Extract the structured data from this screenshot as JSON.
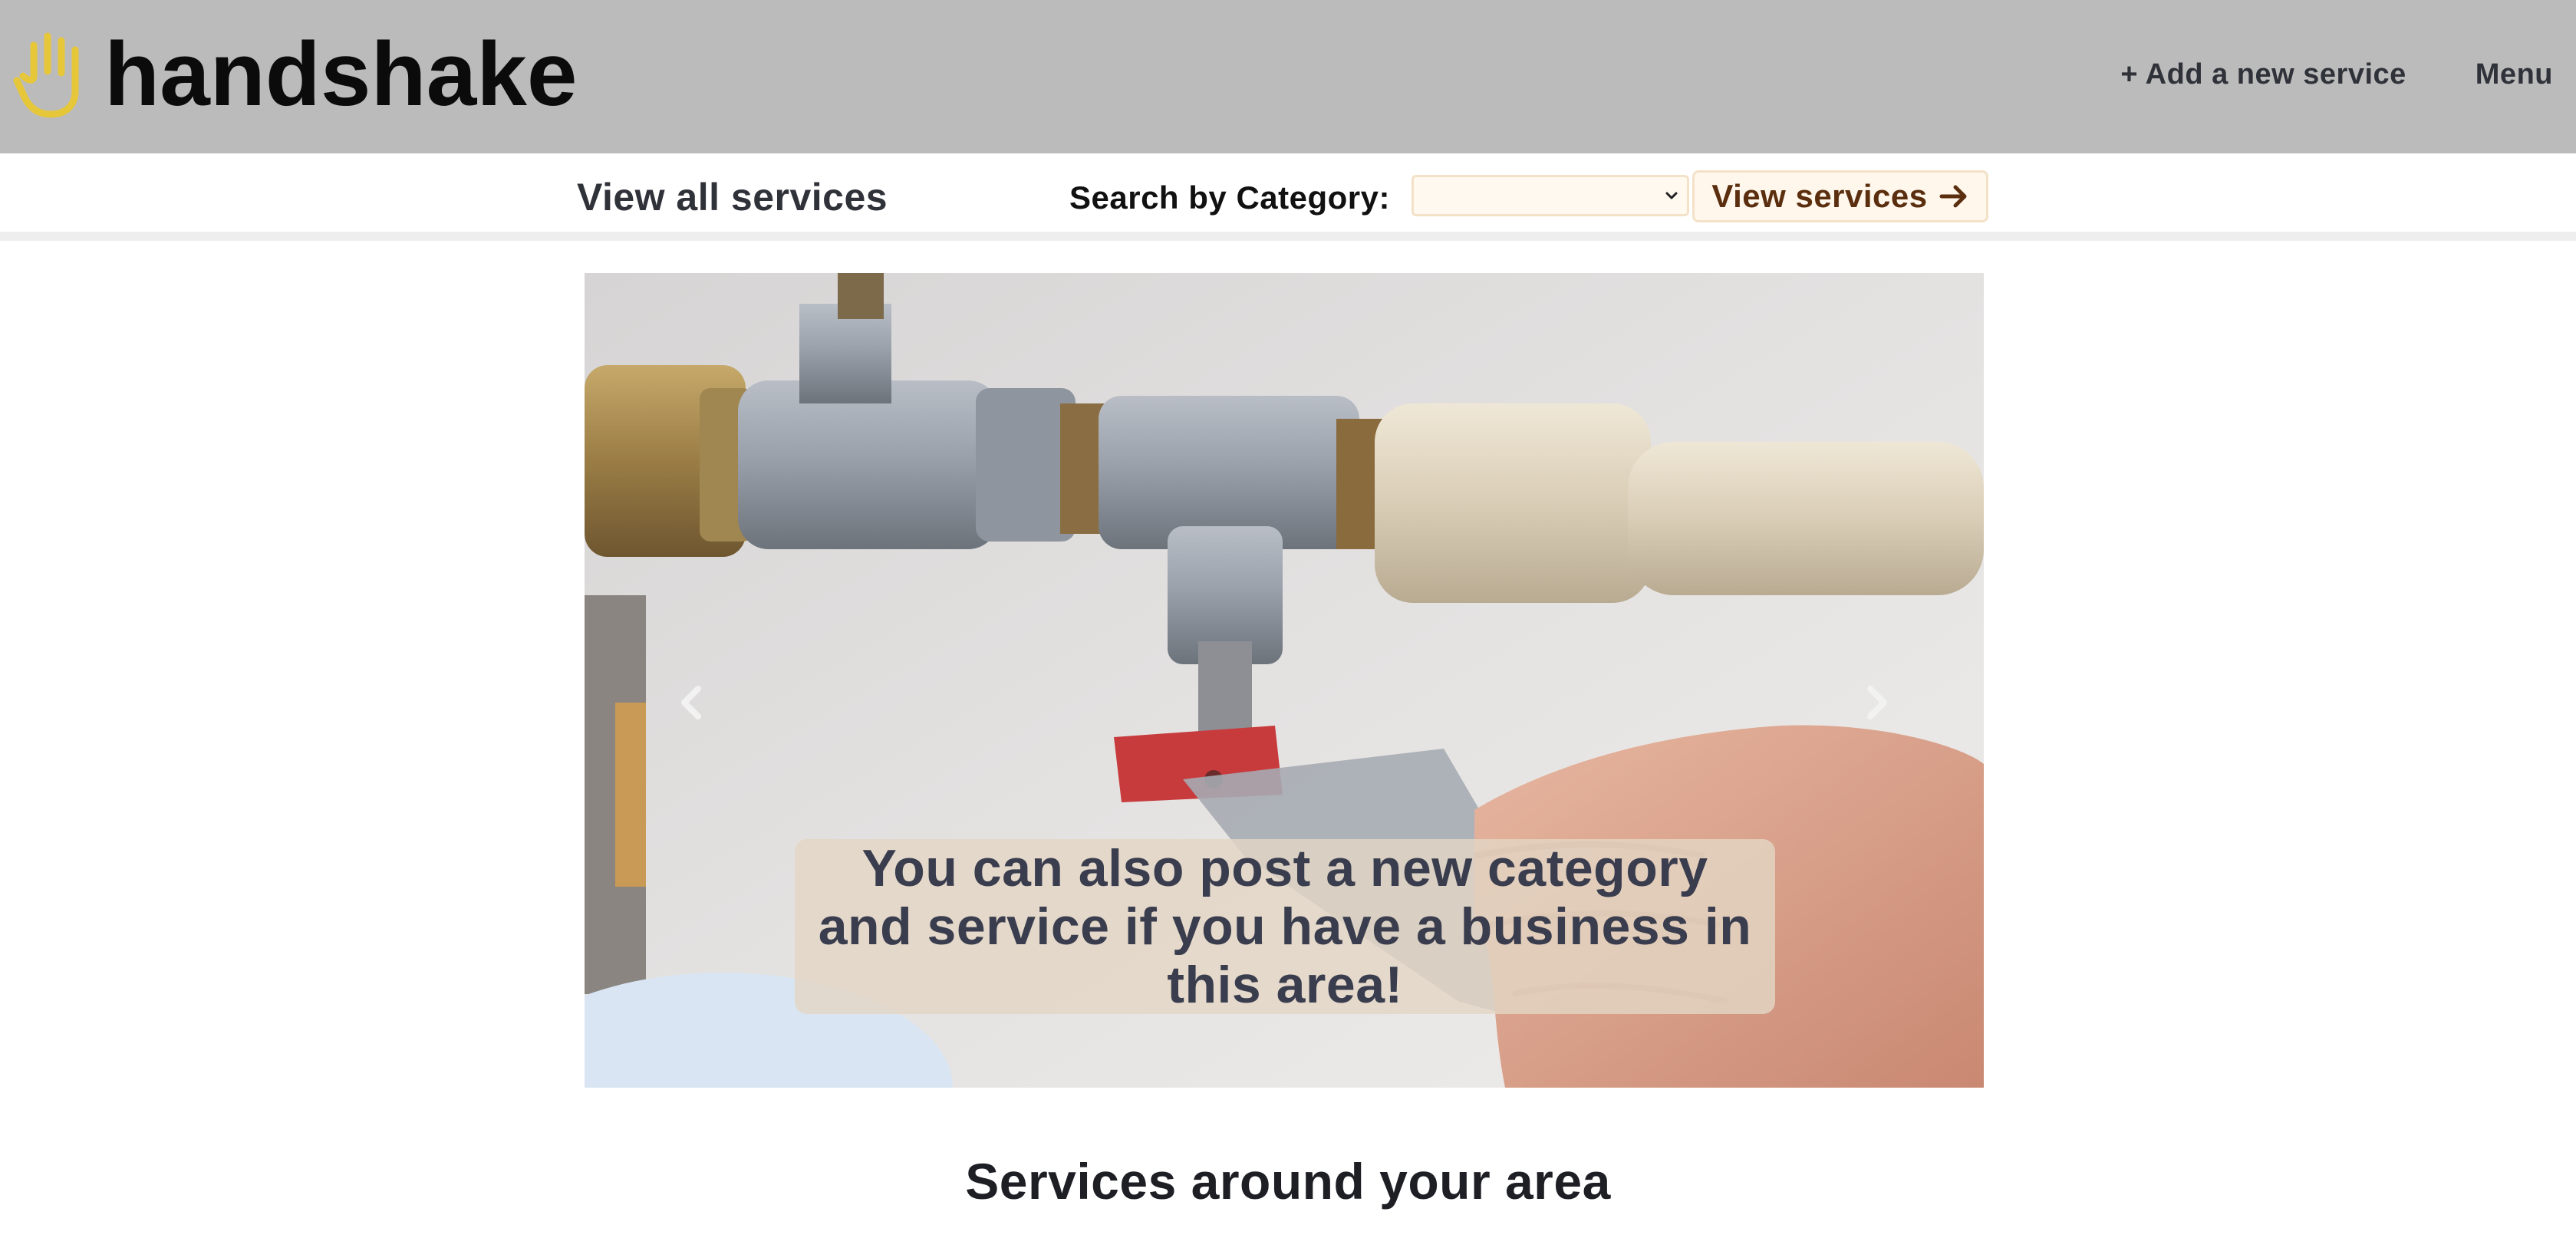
{
  "brand": {
    "name": "handshake",
    "icon": "hand-icon",
    "icon_color": "#e7c73a"
  },
  "header": {
    "add_service": "+ Add a new service",
    "menu": "Menu",
    "background": "#bbbbbb"
  },
  "subnav": {
    "view_all": "View all services",
    "search_label": "Search by Category:",
    "category_selected": "",
    "view_button": "View services",
    "view_button_icon": "arrow-right-icon"
  },
  "carousel": {
    "caption": "You can also post a new category and service if you have a business in this area!",
    "prev_icon": "chevron-left-icon",
    "next_icon": "chevron-right-icon"
  },
  "main": {
    "section_title": "Services around your area"
  }
}
